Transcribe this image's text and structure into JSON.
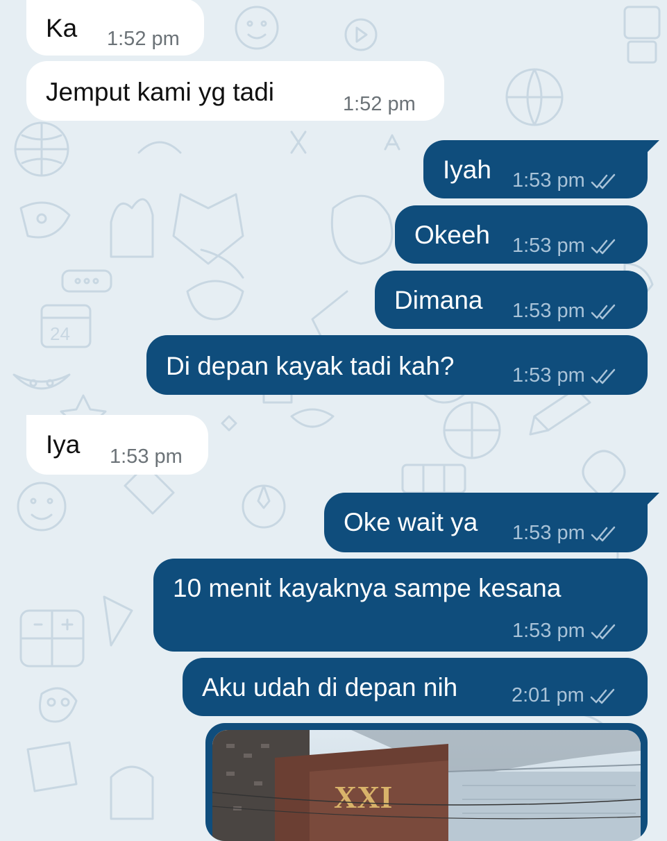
{
  "messages": [
    {
      "direction": "incoming",
      "text": "Ka",
      "time": "1:52 pm"
    },
    {
      "direction": "incoming",
      "text": "Jemput kami yg tadi",
      "time": "1:52 pm"
    },
    {
      "direction": "outgoing",
      "text": "Iyah",
      "time": "1:53 pm",
      "status": "read"
    },
    {
      "direction": "outgoing",
      "text": "Okeeh",
      "time": "1:53 pm",
      "status": "read"
    },
    {
      "direction": "outgoing",
      "text": "Dimana",
      "time": "1:53 pm",
      "status": "read"
    },
    {
      "direction": "outgoing",
      "text": "Di depan kayak tadi kah?",
      "time": "1:53 pm",
      "status": "read"
    },
    {
      "direction": "incoming",
      "text": "Iya",
      "time": "1:53 pm"
    },
    {
      "direction": "outgoing",
      "text": "Oke wait ya",
      "time": "1:53 pm",
      "status": "read"
    },
    {
      "direction": "outgoing",
      "text": "10 menit kayaknya sampe kesana",
      "time": "1:53 pm",
      "status": "read"
    },
    {
      "direction": "outgoing",
      "text": "Aku udah di depan nih",
      "time": "2:01 pm",
      "status": "read"
    }
  ],
  "photo": {
    "sign_text": "XXI"
  },
  "colors": {
    "outgoing_bubble": "#0f4d7c",
    "incoming_bubble": "#ffffff",
    "wallpaper": "#e6eef3",
    "doodle": "#c7d6e1"
  },
  "icons": {
    "read_receipt": "double-check-icon"
  }
}
